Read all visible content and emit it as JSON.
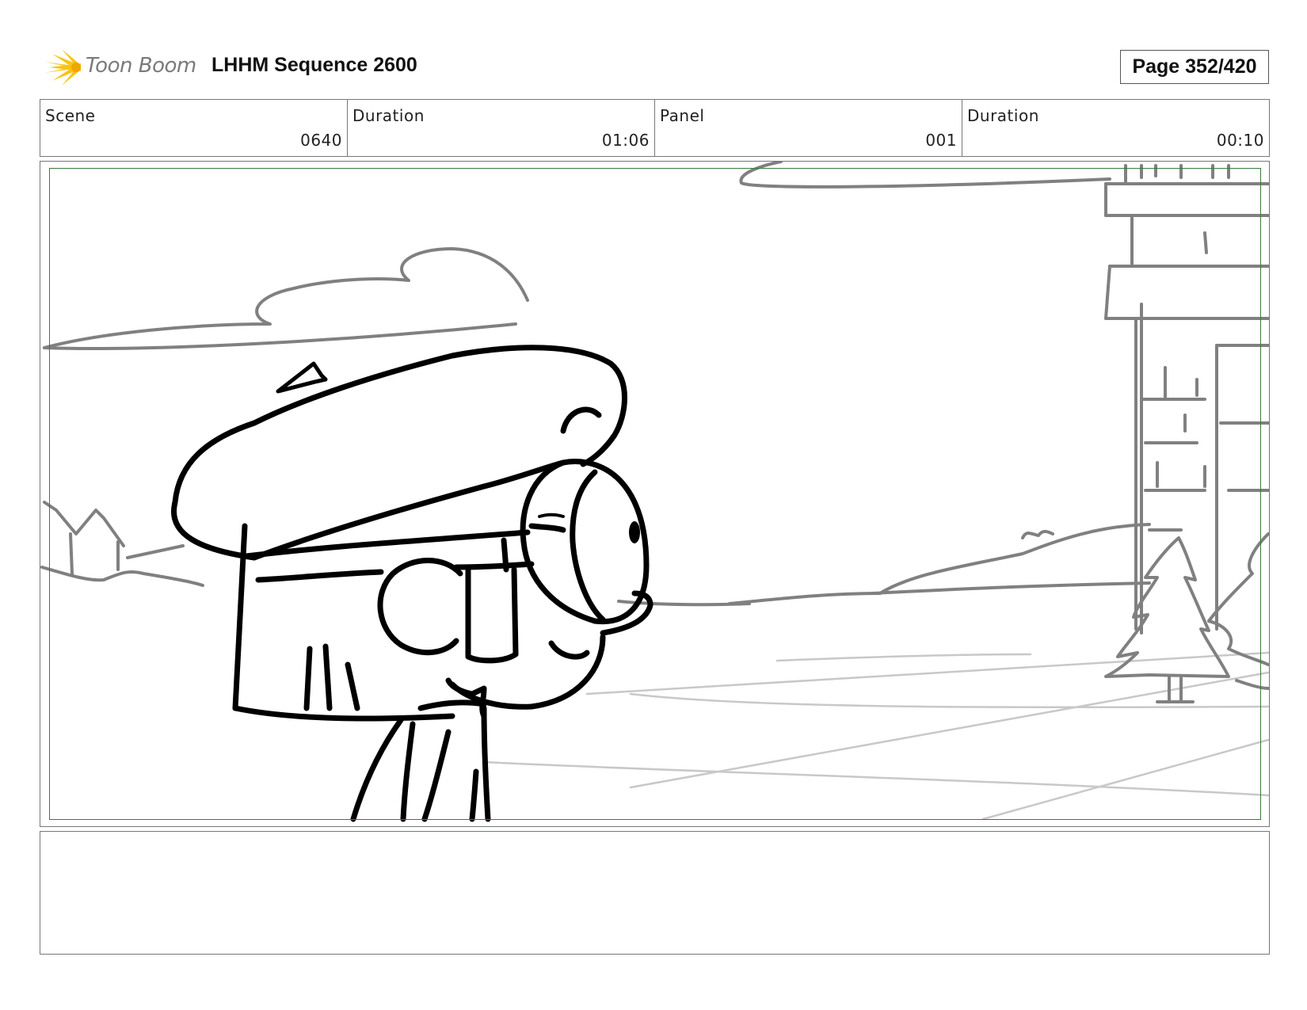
{
  "header": {
    "logo_text": "Toon Boom",
    "sequence_title": "LHHM Sequence 2600",
    "page_label": "Page 352/420"
  },
  "info": [
    {
      "label": "Scene",
      "value": "0640"
    },
    {
      "label": "Duration",
      "value": "01:06"
    },
    {
      "label": "Panel",
      "value": "001"
    },
    {
      "label": "Duration",
      "value": "00:10"
    }
  ],
  "panel": {
    "safe_area_color": "#3b7a3b",
    "sketch_color": "#000000",
    "background_sketch_color": "#808080",
    "perspective_lines_color": "#c8c8c8"
  },
  "notes": {
    "text": ""
  }
}
